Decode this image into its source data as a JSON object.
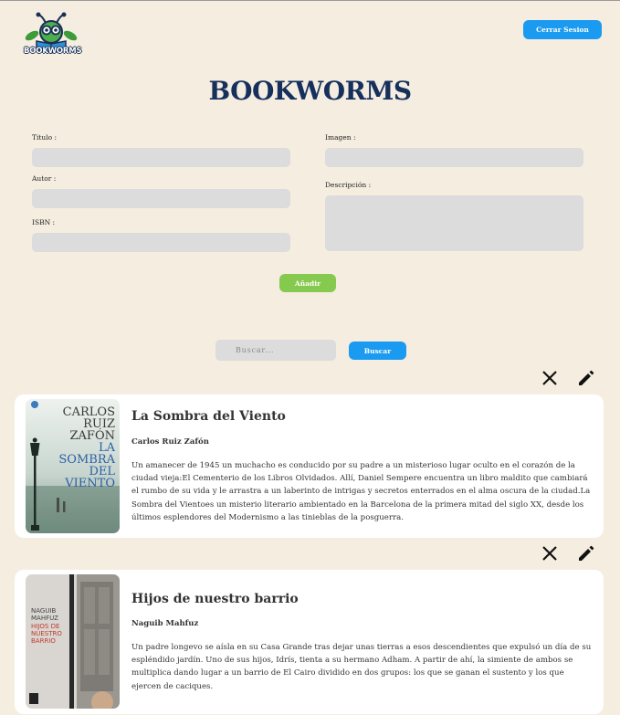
{
  "header": {
    "logo_text": "BOOKWORMS",
    "logout_label": "Cerrar Sesion"
  },
  "page_title": "BOOKWORMS",
  "form": {
    "title_label": "Titulo :",
    "author_label": "Autor :",
    "isbn_label": "ISBN :",
    "image_label": "Imagen :",
    "description_label": "Descripción :",
    "title_value": "",
    "author_value": "",
    "isbn_value": "",
    "image_value": "",
    "description_value": "",
    "add_label": "Añadir"
  },
  "search": {
    "placeholder": "Buscar...",
    "button_label": "Buscar"
  },
  "books": [
    {
      "title": "La Sombra del Viento",
      "author": "Carlos Ruiz Zafón",
      "description": "Un amanecer de 1945 un muchacho es conducido por su padre a un misterioso lugar oculto en el corazón de la ciudad vieja:El Cementerio de los Libros Olvidados. Allí, Daniel Sempere encuentra un libro maldito que cambiará el rumbo de su vida y le arrastra a un laberinto de intrigas y secretos enterrados en el alma oscura de la ciudad.La Sombra del Vientoes un misterio literario ambientado en la Barcelona de la primera mitad del siglo XX, desde los últimos esplendores del Modernismo a las tinieblas de la posguerra.",
      "cover_lines": [
        "CARLOS",
        "RUIZ",
        "ZAFÓN",
        "LA",
        "SOMBRA",
        "DEL",
        "VIENTO"
      ]
    },
    {
      "title": "Hijos de nuestro barrio",
      "author": "Naguib Mahfuz",
      "description": "Un padre longevo se aísla en su Casa Grande tras dejar unas tierras a esos descendientes que expulsó un día de su espléndido jardín. Uno de sus hijos, Idrís, tienta a su hermano Adham. A partir de ahí, la simiente de ambos se multiplica dando lugar a un barrio de El Cairo dividido en dos grupos: los que se ganan el sustento y los que ejercen de caciques.",
      "cover_lines": [
        "NAGUIB",
        "MAHFUZ",
        "HIJOS DE",
        "NUESTRO",
        "BARRIO"
      ]
    }
  ],
  "colors": {
    "background": "#f5ede0",
    "primary_blue": "#1a9af0",
    "title_navy": "#16305e",
    "add_green": "#86c94f",
    "field_gray": "#dcdcdc"
  },
  "icons": {
    "delete": "close-icon",
    "edit": "pencil-icon"
  }
}
